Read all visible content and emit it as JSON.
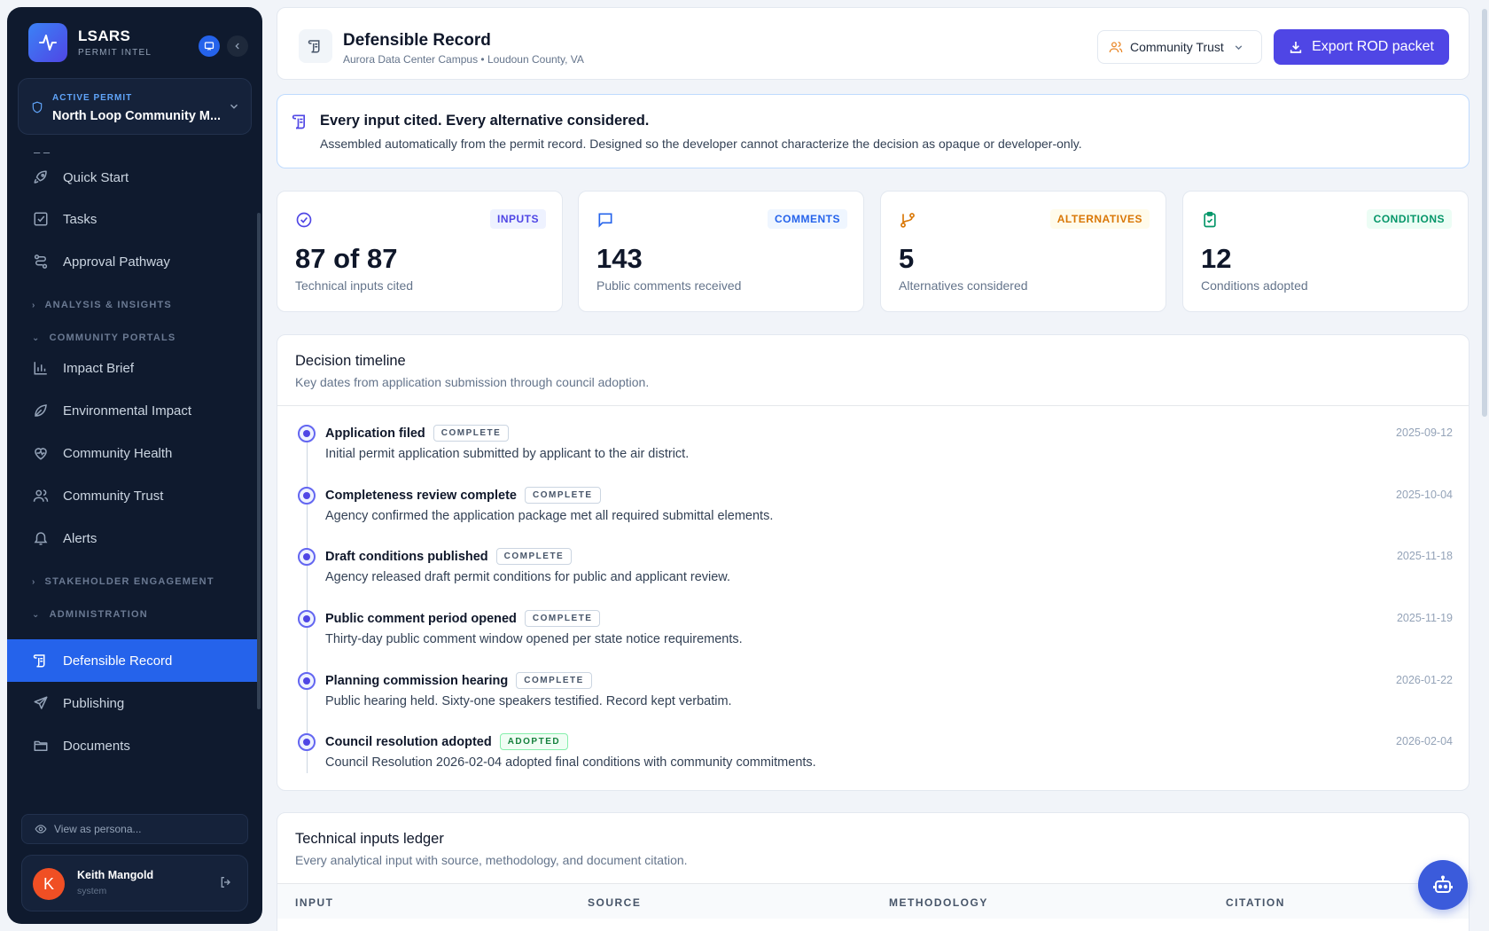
{
  "brand": {
    "name": "LSARS",
    "subtitle": "PERMIT INTEL"
  },
  "permit": {
    "label": "ACTIVE PERMIT",
    "name": "North Loop Community M..."
  },
  "nav": {
    "stub": "– –",
    "items": [
      {
        "label": "Quick Start",
        "icon": "rocket-icon"
      },
      {
        "label": "Tasks",
        "icon": "checkbox-icon"
      },
      {
        "label": "Approval Pathway",
        "icon": "route-icon"
      },
      {
        "label": "Impact Brief",
        "icon": "bar-chart-icon"
      },
      {
        "label": "Environmental Impact",
        "icon": "leaf-icon"
      },
      {
        "label": "Community Health",
        "icon": "heart-pulse-icon"
      },
      {
        "label": "Community Trust",
        "icon": "users-icon"
      },
      {
        "label": "Alerts",
        "icon": "bell-icon"
      },
      {
        "label": "Defensible Record",
        "icon": "scroll-icon"
      },
      {
        "label": "Publishing",
        "icon": "send-icon"
      },
      {
        "label": "Documents",
        "icon": "folder-icon"
      }
    ],
    "sections": {
      "analysis": "ANALYSIS & INSIGHTS",
      "portals": "COMMUNITY PORTALS",
      "stakeholder": "STAKEHOLDER ENGAGEMENT",
      "admin": "ADMINISTRATION"
    }
  },
  "persona": {
    "placeholder": "View as persona..."
  },
  "user": {
    "initial": "K",
    "name": "Keith Mangold",
    "role": "system"
  },
  "header": {
    "title": "Defensible Record",
    "subtitle": "Aurora Data Center Campus • Loudoun County, VA",
    "persona_select": "Community Trust",
    "export_label": "Export ROD packet"
  },
  "banner": {
    "title": "Every input cited. Every alternative considered.",
    "text": "Assembled automatically from the permit record. Designed so the developer cannot characterize the decision as opaque or developer-only."
  },
  "stats": [
    {
      "badge": "INPUTS",
      "value": "87 of 87",
      "label": "Technical inputs cited",
      "color": "#4f46e5",
      "bg": "#eef2ff"
    },
    {
      "badge": "COMMENTS",
      "value": "143",
      "label": "Public comments received",
      "color": "#2563eb",
      "bg": "#eff6ff"
    },
    {
      "badge": "ALTERNATIVES",
      "value": "5",
      "label": "Alternatives considered",
      "color": "#d97706",
      "bg": "#fffbeb"
    },
    {
      "badge": "CONDITIONS",
      "value": "12",
      "label": "Conditions adopted",
      "color": "#059669",
      "bg": "#ecfdf5"
    }
  ],
  "timeline": {
    "title": "Decision timeline",
    "subtitle": "Key dates from application submission through council adoption.",
    "events": [
      {
        "name": "Application filed",
        "status": "COMPLETE",
        "desc": "Initial permit application submitted by applicant to the air district.",
        "date": "2025-09-12"
      },
      {
        "name": "Completeness review complete",
        "status": "COMPLETE",
        "desc": "Agency confirmed the application package met all required submittal elements.",
        "date": "2025-10-04"
      },
      {
        "name": "Draft conditions published",
        "status": "COMPLETE",
        "desc": "Agency released draft permit conditions for public and applicant review.",
        "date": "2025-11-18"
      },
      {
        "name": "Public comment period opened",
        "status": "COMPLETE",
        "desc": "Thirty-day public comment window opened per state notice requirements.",
        "date": "2025-11-19"
      },
      {
        "name": "Planning commission hearing",
        "status": "COMPLETE",
        "desc": "Public hearing held. Sixty-one speakers testified. Record kept verbatim.",
        "date": "2026-01-22"
      },
      {
        "name": "Council resolution adopted",
        "status": "ADOPTED",
        "desc": "Council Resolution 2026-02-04 adopted final conditions with community commitments.",
        "date": "2026-02-04"
      }
    ]
  },
  "ledger": {
    "title": "Technical inputs ledger",
    "subtitle": "Every analytical input with source, methodology, and document citation.",
    "columns": [
      "INPUT",
      "SOURCE",
      "METHODOLOGY",
      "CITATION"
    ]
  }
}
